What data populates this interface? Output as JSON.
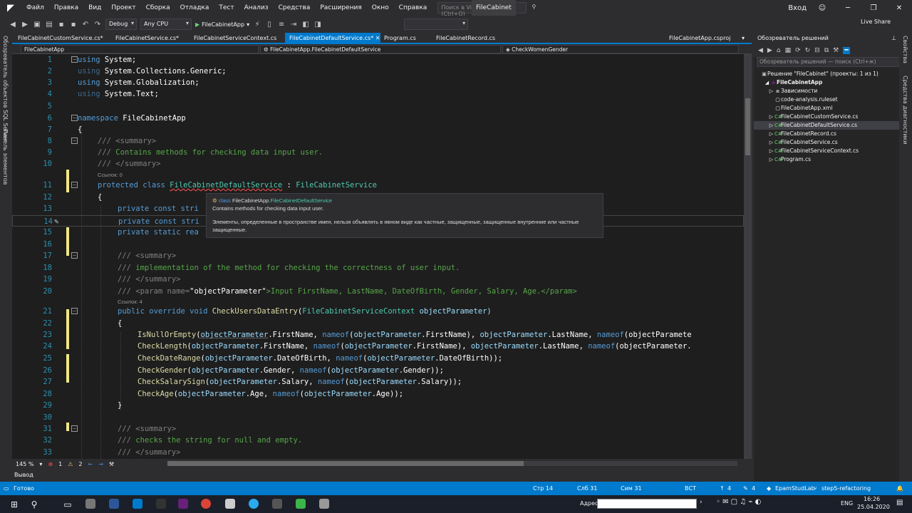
{
  "menubar": {
    "logo": "◤",
    "items": [
      "Файл",
      "Правка",
      "Вид",
      "Проект",
      "Сборка",
      "Отладка",
      "Тест",
      "Анализ",
      "Средства",
      "Расширения",
      "Окно",
      "Справка"
    ],
    "search_placeholder": "Поиск в Visual Studio (Ctrl+Q)",
    "solution_name": "FileCabinet",
    "login": "Вход"
  },
  "toolbar": {
    "config": "Debug",
    "platform": "Any CPU",
    "run_target": "FileCabinetApp",
    "live_share": "Live Share"
  },
  "left_rail": {
    "panel1": "Обозреватель объектов SQL Server",
    "panel2": "Панель элементов"
  },
  "tabs": [
    {
      "label": "FileCabinetCustomService.cs*",
      "active": false
    },
    {
      "label": "FileCabinetService.cs*",
      "active": false
    },
    {
      "label": "FileCabinetServiceContext.cs",
      "active": false
    },
    {
      "label": "FileCabinetDefaultService.cs*",
      "active": true
    },
    {
      "label": "Program.cs",
      "active": false
    },
    {
      "label": "FileCabinetRecord.cs",
      "active": false
    },
    {
      "label": "FileCabinetApp.csproj",
      "active": false
    }
  ],
  "navbar": {
    "project": "FileCabinetApp",
    "type": "FileCabinetApp.FileCabinetDefaultService",
    "member": "CheckWomenGender"
  },
  "code": {
    "l1": "1",
    "l2": "2",
    "l3": "3",
    "l4": "4",
    "l5": "5",
    "l6": "6",
    "l7": "7",
    "l8": "8",
    "l9": "9",
    "l10": "10",
    "l11": "11",
    "l12": "12",
    "l13": "13",
    "l14": "14",
    "l15": "15",
    "l16": "16",
    "l17": "17",
    "l18": "18",
    "l19": "19",
    "l20": "20",
    "l21": "21",
    "l22": "22",
    "l23": "23",
    "l24": "24",
    "l25": "25",
    "l26": "26",
    "l27": "27",
    "l28": "28",
    "l29": "29",
    "l30": "30",
    "l31": "31",
    "l32": "32",
    "l33": "33",
    "refs0": "Ссылок: 0",
    "refs4": "Ссылок: 4",
    "using": "using",
    "u1": " System;",
    "u2": " System.Collections.Generic;",
    "u3": " System.Globalization;",
    "u4": " System.Text;",
    "namespace": "namespace",
    "ns": " FileCabinetApp",
    "ob": "{",
    "cb": "}",
    "doc_slashes": "///",
    "summary_open": " <summary>",
    "summary_close": " </summary>",
    "c9": " Contains methods for checking data input user.",
    "protected": "protected",
    "class": " class ",
    "cls": "FileCabinetDefaultService",
    "colon": " : ",
    "base": "FileCabinetService",
    "private": "private",
    "const": " const ",
    "stri": "stri",
    "static": " static ",
    "rea": "rea",
    "c18": " implementation of the method for checking the correctness of user input.",
    "param_open": " <param ",
    "param_name": "name",
    "eq": "=",
    "param_val": "\"objectParameter\"",
    "param_text": ">Input FirstName, LastName, DateOfBirth, Gender, Salary, Age.</param>",
    "public": "public",
    "override": " override",
    "void": " void",
    "m21": " CheckUsersDataEntry",
    "p21a": "(",
    "ctx": "FileCabinetServiceContext",
    "p21b": " objectParameter)",
    "m23": "IsNullOrEmpty",
    "m24": "CheckLength",
    "m25": "CheckDateRange",
    "m26": "CheckGender",
    "m27": "CheckSalarySign",
    "m28": "CheckAge",
    "op": "objectParameter",
    "nameof": "nameof",
    "a23a": "(",
    "a23b": ".FirstName, ",
    "a23c": "(",
    "a23d": ".FirstName), ",
    "a23e": ".LastName, ",
    "a23f": "(objectParamete",
    "a24f": "(objectParameter.",
    "a25b": ".DateOfBirth, ",
    "a25d": ".DateOfBirth));",
    "a26b": ".Gender, ",
    "a26d": ".Gender));",
    "a27b": ".Salary, ",
    "a27d": ".Salary));",
    "a28b": ".Age, ",
    "a28d": ".Age));",
    "c32": " checks the string for null and empty."
  },
  "tooltip": {
    "kind": "class",
    "ns": "FileCabinetApp.",
    "type": "FileCabinetDefaultService",
    "summary": "Contains methods for checking data input user.",
    "error": "Элементы, определенные в пространстве имен, нельзя объявлять в явном виде как частные, защищенные, защищенные внутренние или частные защищенные."
  },
  "editor_bottom": {
    "zoom": "145 %",
    "errors": "1",
    "warnings": "2"
  },
  "output_label": "Вывод",
  "solution_explorer": {
    "title": "Обозреватель решений",
    "search_placeholder": "Обозреватель решений — поиск (Ctrl+ж)",
    "items": [
      {
        "label": "Решение \"FileCabinet\" (проекты: 1 из 1)",
        "level": 0,
        "selected": false
      },
      {
        "label": "FileCabinetApp",
        "level": 1,
        "selected": false
      },
      {
        "label": "Зависимости",
        "level": 2,
        "selected": false
      },
      {
        "label": "code-analysis.ruleset",
        "level": 2,
        "selected": false
      },
      {
        "label": "FileCabinetApp.xml",
        "level": 2,
        "selected": false
      },
      {
        "label": "FileCabinetCustomService.cs",
        "level": 2,
        "selected": false
      },
      {
        "label": "FileCabinetDefaultService.cs",
        "level": 2,
        "selected": true
      },
      {
        "label": "FileCabinetRecord.cs",
        "level": 2,
        "selected": false
      },
      {
        "label": "FileCabinetService.cs",
        "level": 2,
        "selected": false
      },
      {
        "label": "FileCabinetServiceContext.cs",
        "level": 2,
        "selected": false
      },
      {
        "label": "Program.cs",
        "level": 2,
        "selected": false
      }
    ]
  },
  "right_rail": {
    "panel1": "Свойства",
    "panel2": "Средства диагностики"
  },
  "statusbar": {
    "ready": "Готово",
    "line": "Стр 14",
    "col": "Слб 31",
    "ch": "Сим 31",
    "mode": "ВСТ",
    "up": "4",
    "pencil": "4",
    "repo": "EpamStudLab",
    "branch": "step5-refactoring"
  },
  "taskbar": {
    "address_label": "Адрес",
    "lang": "ENG",
    "time": "16:26",
    "date": "25.04.2020"
  },
  "colors": {
    "accent": "#007acc",
    "editor_bg": "#1e1e1e",
    "keyword": "#569cd6",
    "type": "#4ec9b0",
    "comment": "#57a64a"
  }
}
